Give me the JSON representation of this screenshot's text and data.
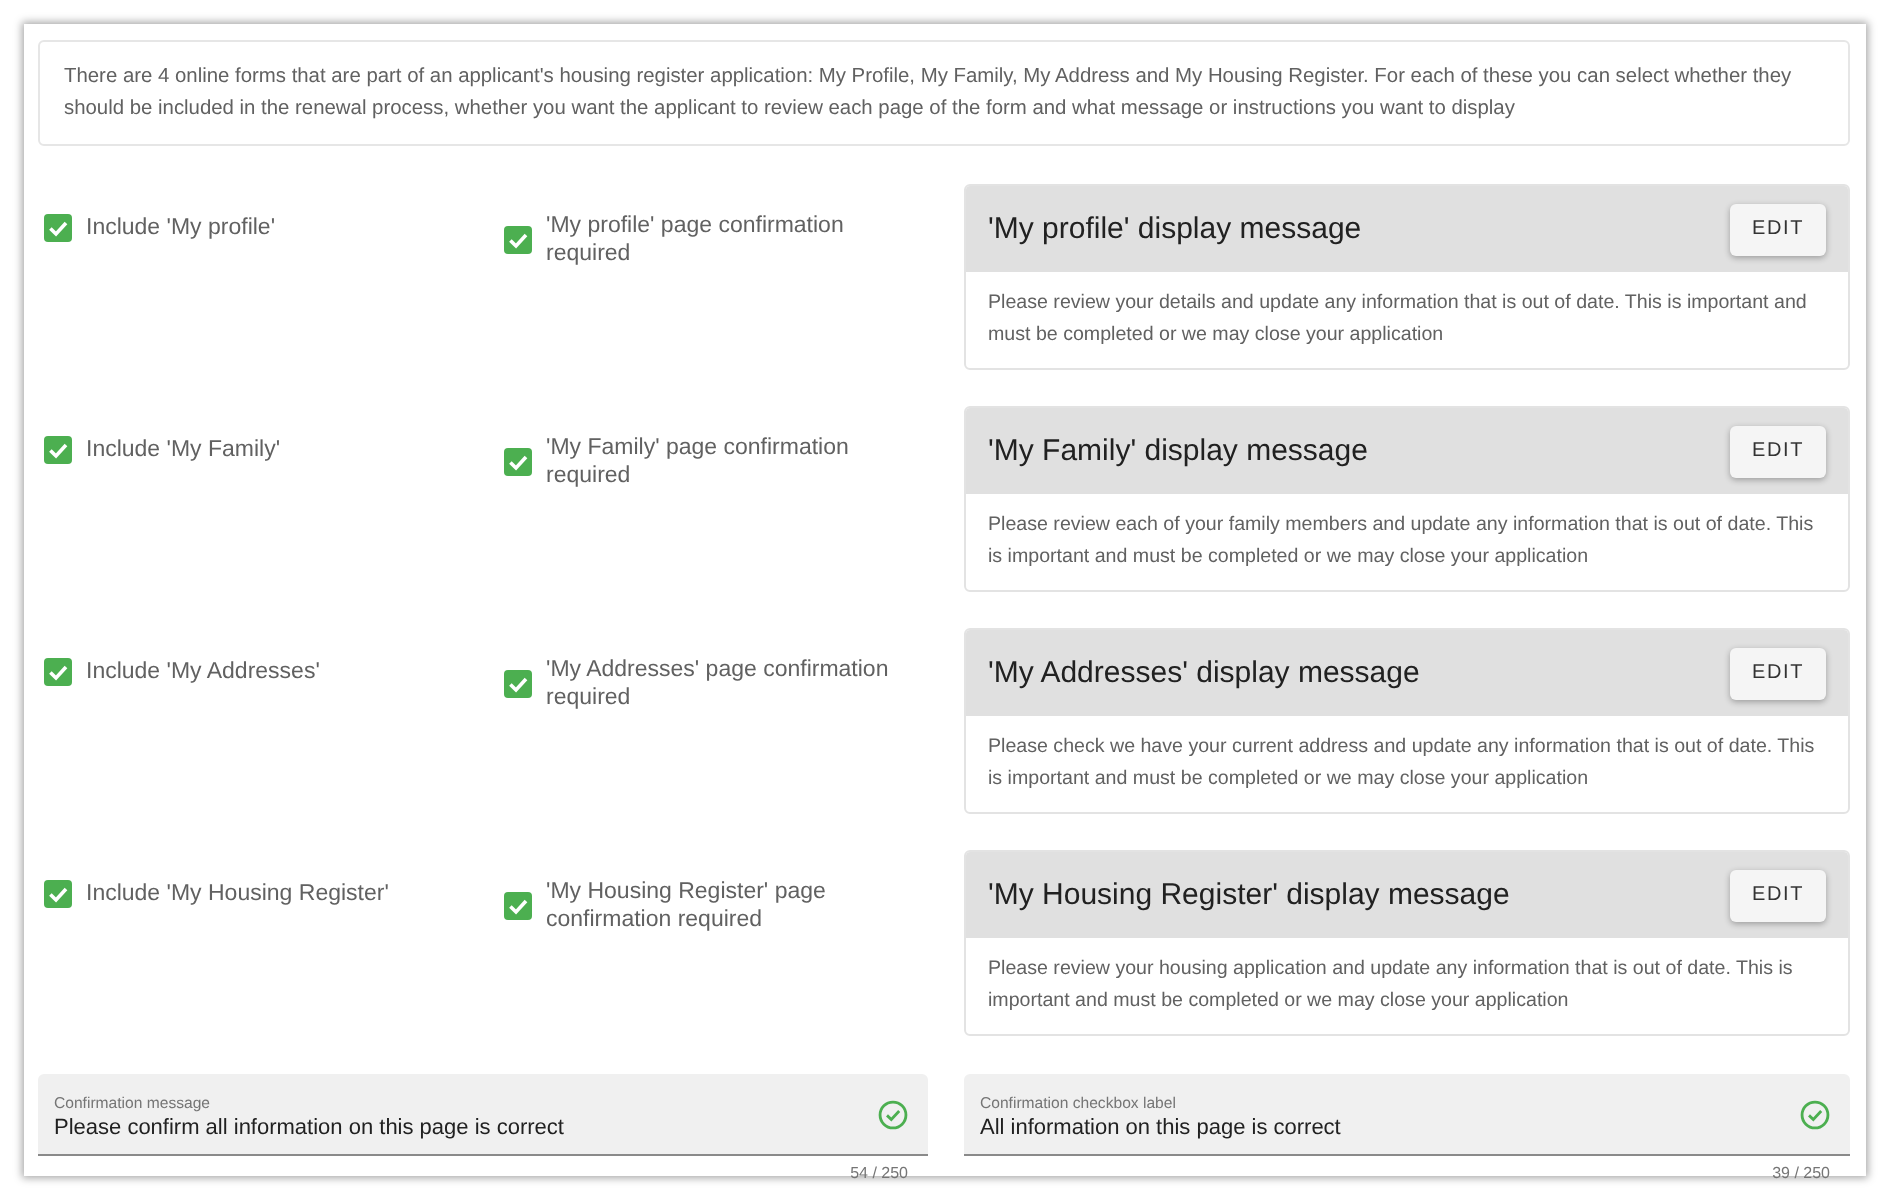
{
  "intro": "There are 4 online forms that are part of an applicant's housing register application: My Profile, My Family, My Address and My Housing Register. For each of these you can select whether they should be included in the renewal process, whether you want the applicant to review each page of the form and what message or instructions you want to display",
  "sections": [
    {
      "include": {
        "label": "Include 'My profile'",
        "checked": true
      },
      "confirmation": {
        "label": "'My profile' page confirmation required",
        "checked": true
      },
      "message_card": {
        "title": "'My profile' display message",
        "button": "EDIT",
        "message": "Please review your details and update any information that is out of date. This is important and must be completed or we may close your application"
      }
    },
    {
      "include": {
        "label": "Include 'My Family'",
        "checked": true
      },
      "confirmation": {
        "label": "'My Family' page confirmation required",
        "checked": true
      },
      "message_card": {
        "title": "'My Family' display message",
        "button": "EDIT",
        "message": "Please review each of your family members and update any information that is out of date. This is important and must be completed or we may close your application"
      }
    },
    {
      "include": {
        "label": "Include 'My Addresses'",
        "checked": true
      },
      "confirmation": {
        "label": "'My Addresses' page confirmation required",
        "checked": true
      },
      "message_card": {
        "title": "'My Addresses' display message",
        "button": "EDIT",
        "message": "Please check we have your current address and update any information that is out of date. This is important and must be completed or we may close your application"
      }
    },
    {
      "include": {
        "label": "Include 'My Housing Register'",
        "checked": true
      },
      "confirmation": {
        "label": "'My Housing Register' page confirmation required",
        "checked": true
      },
      "message_card": {
        "title": "'My Housing Register' display message",
        "button": "EDIT",
        "message": "Please review your housing application and update any information that is out of date. This is important and must be completed or we may close your application"
      }
    }
  ],
  "fields": [
    {
      "label": "Confirmation message",
      "value": "Please confirm all information on this page is correct",
      "valid": true,
      "counter": "54 / 250"
    },
    {
      "label": "Confirmation checkbox label",
      "value": "All information on this page is correct",
      "valid": true,
      "counter": "39 / 250"
    }
  ]
}
